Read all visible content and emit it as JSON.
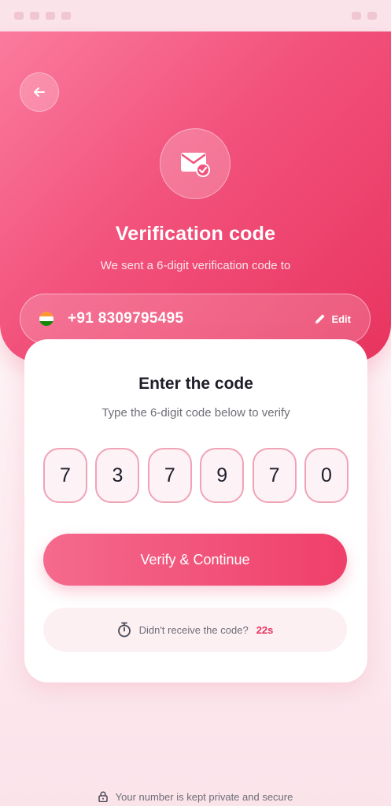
{
  "header": {
    "title": "Verification code",
    "subtitle": "We sent a 6-digit verification code to"
  },
  "phone": {
    "number": "+91 8309795495",
    "edit_label": "Edit"
  },
  "card": {
    "title": "Enter the code",
    "subtitle": "Type the 6-digit code below to verify",
    "digits": [
      "7",
      "3",
      "7",
      "9",
      "7",
      "0"
    ],
    "verify_label": "Verify & Continue",
    "resend_text": "Didn't receive the code?",
    "resend_countdown": "22s"
  },
  "footer": {
    "privacy_text": "Your number is kept private and secure"
  },
  "icons": {
    "back": "arrow-left-icon",
    "mail": "mail-check-icon",
    "flag": "india-flag-icon",
    "edit": "pencil-icon",
    "timer": "stopwatch-icon",
    "lock": "lock-icon"
  },
  "colors": {
    "accent": "#ef3f6a",
    "accent_light": "#fb7b9d",
    "otp_border": "#f0a3b7"
  }
}
